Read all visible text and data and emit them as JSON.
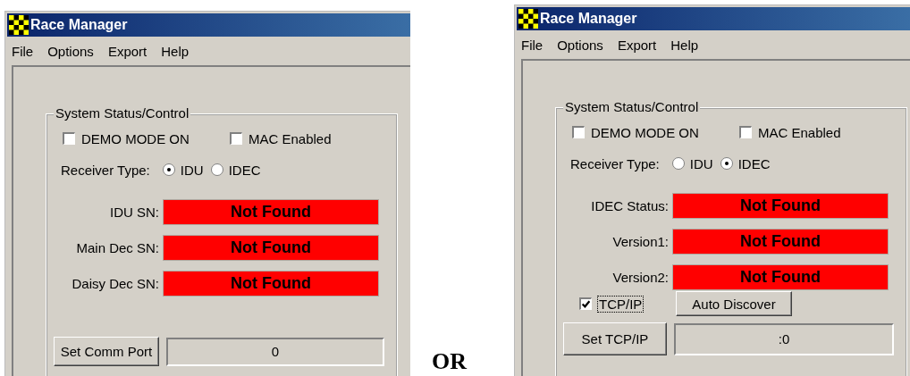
{
  "windows": [
    {
      "title": "Race Manager",
      "menu": [
        "File",
        "Options",
        "Export",
        "Help"
      ],
      "group_title": "System Status/Control",
      "checkboxes": [
        {
          "label": "DEMO MODE ON",
          "checked": false
        },
        {
          "label": "MAC Enabled",
          "checked": false
        }
      ],
      "receiver_label": "Receiver Type:",
      "receiver_options": [
        {
          "label": "IDU",
          "selected": true
        },
        {
          "label": "IDEC",
          "selected": false
        }
      ],
      "status_rows": [
        {
          "label": "IDU SN:",
          "value": "Not Found"
        },
        {
          "label": "Main Dec SN:",
          "value": "Not Found"
        },
        {
          "label": "Daisy Dec SN:",
          "value": "Not Found"
        }
      ],
      "set_button": "Set Comm Port",
      "port_value": "0"
    },
    {
      "title": "Race Manager",
      "menu": [
        "File",
        "Options",
        "Export",
        "Help"
      ],
      "group_title": "System Status/Control",
      "checkboxes": [
        {
          "label": "DEMO MODE ON",
          "checked": false
        },
        {
          "label": "MAC Enabled",
          "checked": false
        }
      ],
      "receiver_label": "Receiver Type:",
      "receiver_options": [
        {
          "label": "IDU",
          "selected": false
        },
        {
          "label": "IDEC",
          "selected": true
        }
      ],
      "status_rows": [
        {
          "label": "IDEC Status:",
          "value": "Not Found"
        },
        {
          "label": "Version1:",
          "value": "Not Found"
        },
        {
          "label": "Version2:",
          "value": "Not Found"
        }
      ],
      "tcp": {
        "label": "TCP/IP",
        "checked": true
      },
      "auto_discover": "Auto Discover",
      "set_button": "Set TCP/IP",
      "port_value": ":0"
    }
  ],
  "separator": "OR"
}
